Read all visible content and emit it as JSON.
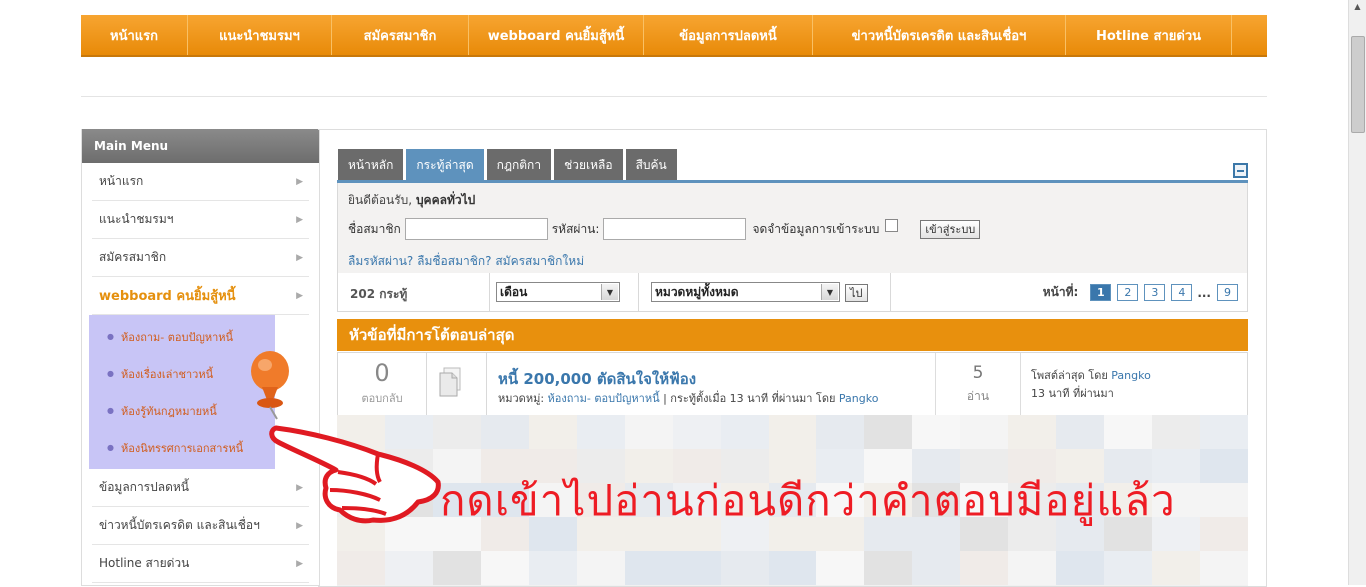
{
  "topnav": {
    "items": [
      {
        "label": "หน้าแรก"
      },
      {
        "label": "แนะนำชมรมฯ"
      },
      {
        "label": "สมัครสมาชิก"
      },
      {
        "label": "webboard คนยิ้มสู้หนี้"
      },
      {
        "label": "ข้อมูลการปลดหนี้"
      },
      {
        "label": "ข่าวหนี้บัตรเครดิต และสินเชื่อฯ"
      },
      {
        "label": "Hotline สายด่วน"
      }
    ]
  },
  "sidebar": {
    "title": "Main Menu",
    "items": [
      {
        "label": "หน้าแรก"
      },
      {
        "label": "แนะนำชมรมฯ"
      },
      {
        "label": "สมัครสมาชิก"
      },
      {
        "label": "webboard คนยิ้มสู้หนี้"
      }
    ],
    "submenu": [
      {
        "label": "ห้องถาม- ตอบปัญหาหนี้"
      },
      {
        "label": "ห้องเรื่องเล่าชาวหนี้"
      },
      {
        "label": "ห้องรู้ทันกฎหมายหนี้"
      },
      {
        "label": "ห้องนิทรรศการเอกสารหนี้"
      }
    ],
    "items_after": [
      {
        "label": "ข้อมูลการปลดหนี้"
      },
      {
        "label": "ข่าวหนี้บัตรเครดิต และสินเชื่อฯ"
      },
      {
        "label": "Hotline สายด่วน"
      }
    ]
  },
  "tabs": [
    {
      "label": "หน้าหลัก"
    },
    {
      "label": "กระทู้ล่าสุด"
    },
    {
      "label": "กฎกติกา"
    },
    {
      "label": "ช่วยเหลือ"
    },
    {
      "label": "สืบค้น"
    }
  ],
  "login": {
    "welcome_prefix": "ยินดีต้อนรับ,",
    "welcome_user": "บุคคลทั่วไป",
    "username_label": "ชื่อสมาชิก",
    "password_label": "รหัสผ่าน:",
    "remember_label": "จดจำข้อมูลการเข้าระบบ",
    "login_button": "เข้าสู่ระบบ",
    "forgot_password": "ลืมรหัสผ่าน?",
    "forgot_username": "ลืมชื่อสมาชิก?",
    "register": "สมัครสมาชิกใหม่"
  },
  "filters": {
    "post_count": "202 กระทู้",
    "period_select": "เดือน",
    "category_select": "หมวดหมู่ทั้งหมด",
    "go_button": "ไป",
    "page_label": "หน้าที่:",
    "pages": [
      "1",
      "2",
      "3",
      "4"
    ],
    "ellipsis": "...",
    "last_page": "9"
  },
  "topics": {
    "header": "หัวข้อที่มีการโต้ตอบล่าสุด",
    "rows": [
      {
        "replies": "0",
        "replies_label": "ตอบกลับ",
        "title": "หนี้ 200,000 ตัดสินใจให้ฟ้อง",
        "category_label": "หมวดหมู่:",
        "category": "ห้องถาม- ตอบปัญหาหนี้",
        "created_text": "| กระทู้ตั้งเมื่อ 13 นาที ที่ผ่านมา โดย",
        "author": "Pangko",
        "views": "5",
        "views_label": "อ่าน",
        "last_post_label": "โพสต์ล่าสุด โดย",
        "last_post_author": "Pangko",
        "last_post_time": "13 นาที ที่ผ่านมา"
      }
    ]
  },
  "overlay": {
    "hint_text": "กดเข้าไปอ่านก่อนดีกว่าคำตอบมีอยู่แล้ว"
  },
  "colors": {
    "nav_orange": "#e88a08",
    "tab_blue": "#5e92bd",
    "link_blue": "#3a77ac",
    "hint_red": "#ee1c24",
    "submenu_lilac": "#c8c5f6"
  }
}
